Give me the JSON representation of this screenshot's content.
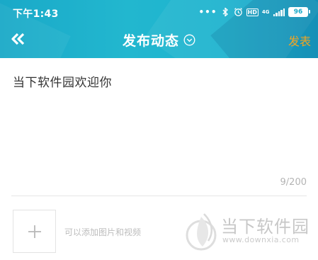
{
  "status_bar": {
    "time": "下午1:43",
    "hd_label": "HD",
    "network_label": "4G",
    "battery": "96",
    "icons": [
      "more-dots-icon",
      "bluetooth-icon",
      "alarm-icon",
      "hd-icon",
      "signal-icon",
      "battery-icon"
    ]
  },
  "nav": {
    "back_icon": "double-chevron-left-icon",
    "title": "发布动态",
    "title_icon": "chevron-down-circle-icon",
    "publish_label": "发表",
    "publish_color": "#f2a521",
    "header_color": "#1aa9c8"
  },
  "editor": {
    "text": "当下软件园欢迎你",
    "char_count": "9/200"
  },
  "media": {
    "add_icon": "plus-icon",
    "hint": "可以添加图片和视频"
  },
  "watermark": {
    "title": "当下软件园",
    "url": "www.downxia.com"
  }
}
